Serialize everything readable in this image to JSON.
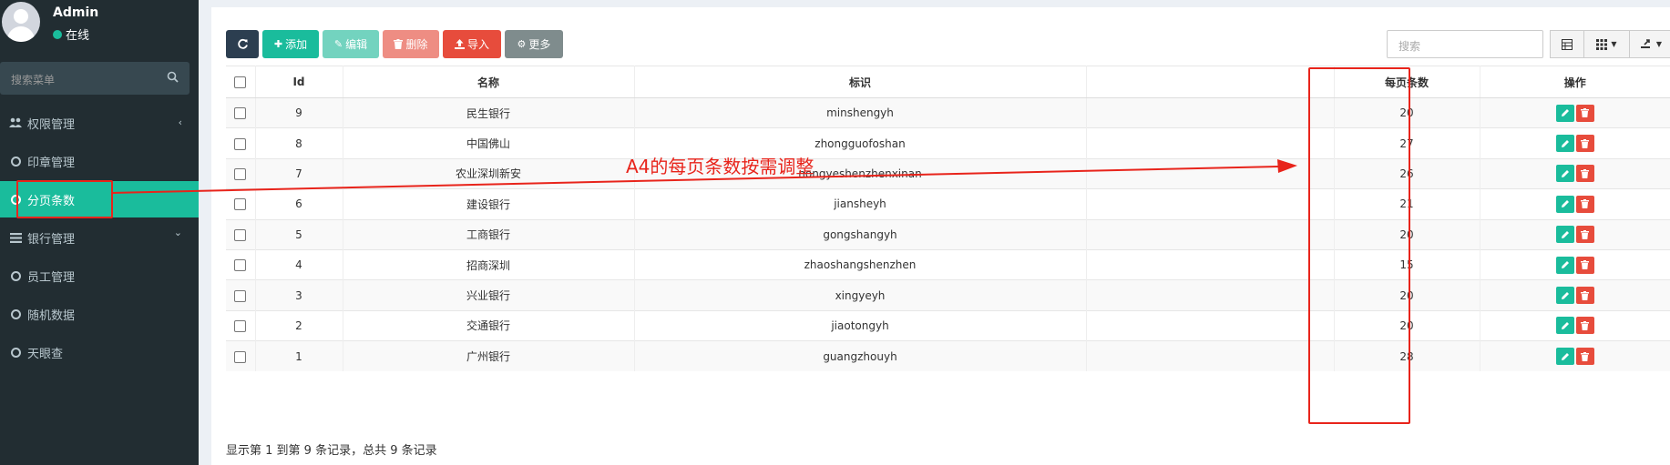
{
  "user": {
    "name": "Admin",
    "status": "在线"
  },
  "sidebar": {
    "search_placeholder": "搜索菜单",
    "items": [
      {
        "label": "权限管理",
        "icon": "users-icon",
        "chevron": "‹"
      },
      {
        "label": "印章管理",
        "icon": "circle-icon"
      },
      {
        "label": "分页条数",
        "icon": "circle-icon",
        "active": true
      },
      {
        "label": "银行管理",
        "icon": "list-icon",
        "chevron": "⌄"
      },
      {
        "label": "员工管理",
        "icon": "circle-icon"
      },
      {
        "label": "随机数据",
        "icon": "circle-icon"
      },
      {
        "label": "天眼查",
        "icon": "circle-icon"
      }
    ]
  },
  "toolbar": {
    "add_label": "添加",
    "edit_label": "编辑",
    "delete_label": "删除",
    "import_label": "导入",
    "more_label": "更多",
    "search_placeholder": "搜索"
  },
  "table": {
    "headers": {
      "id": "Id",
      "name": "名称",
      "code": "标识",
      "page_size": "每页条数",
      "ops": "操作"
    },
    "rows": [
      {
        "id": "9",
        "name": "民生银行",
        "code": "minshengyh",
        "page_size": "20"
      },
      {
        "id": "8",
        "name": "中国佛山",
        "code": "zhongguofoshan",
        "page_size": "27"
      },
      {
        "id": "7",
        "name": "农业深圳新安",
        "code": "nongyeshenzhenxinan",
        "page_size": "26"
      },
      {
        "id": "6",
        "name": "建设银行",
        "code": "jiansheyh",
        "page_size": "21"
      },
      {
        "id": "5",
        "name": "工商银行",
        "code": "gongshangyh",
        "page_size": "20"
      },
      {
        "id": "4",
        "name": "招商深圳",
        "code": "zhaoshangshenzhen",
        "page_size": "15"
      },
      {
        "id": "3",
        "name": "兴业银行",
        "code": "xingyeyh",
        "page_size": "20"
      },
      {
        "id": "2",
        "name": "交通银行",
        "code": "jiaotongyh",
        "page_size": "20"
      },
      {
        "id": "1",
        "name": "广州银行",
        "code": "guangzhouyh",
        "page_size": "28"
      }
    ]
  },
  "footer": {
    "info": "显示第 1 到第 9 条记录，总共 9 条记录"
  },
  "annotation": {
    "text": "A4的每页条数按需调整",
    "color": "#e8241b"
  },
  "colors": {
    "sidebar_bg": "#222d32",
    "accent": "#1abc9c",
    "danger": "#e74c3c",
    "dark": "#2c3e50"
  }
}
